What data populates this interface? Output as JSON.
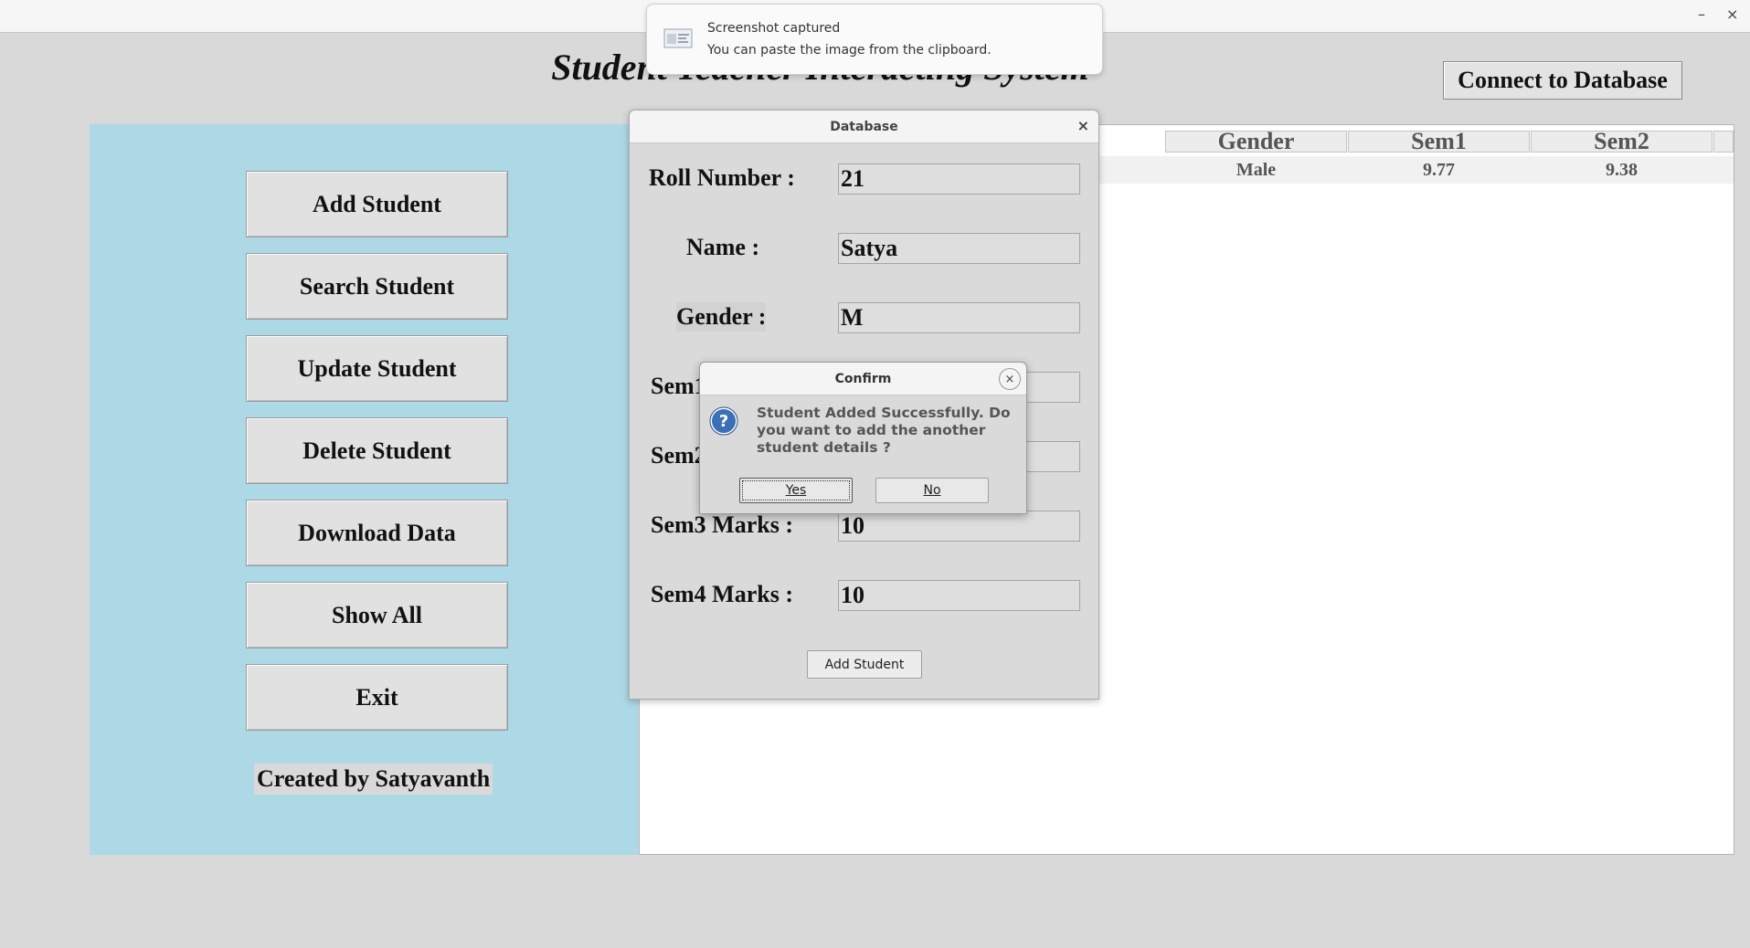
{
  "window": {
    "minimize_glyph": "–",
    "close_glyph": "×"
  },
  "app": {
    "title": "Student Teacher Interacting System",
    "connect_button": "Connect to Database"
  },
  "sidebar": {
    "buttons": [
      "Add Student",
      "Search Student",
      "Update Student",
      "Delete Student",
      "Download Data",
      "Show All",
      "Exit"
    ],
    "credit": "Created by Satyavanth"
  },
  "table": {
    "columns": [
      "Gender",
      "Sem1",
      "Sem2"
    ],
    "rows": [
      [
        "Male",
        "9.77",
        "9.38"
      ]
    ]
  },
  "database_dialog": {
    "title": "Database",
    "close_glyph": "×",
    "fields": [
      {
        "label": "Roll Number :",
        "value": "21"
      },
      {
        "label": "Name :",
        "value": "Satya"
      },
      {
        "label": "Gender :",
        "value": "M"
      },
      {
        "label": "Sem1",
        "value": ""
      },
      {
        "label": "Sem2",
        "value": ""
      },
      {
        "label": "Sem3 Marks :",
        "value": "10"
      },
      {
        "label": "Sem4 Marks :",
        "value": "10"
      }
    ],
    "submit_button": "Add Student"
  },
  "confirm_dialog": {
    "title": "Confirm",
    "close_glyph": "×",
    "icon": "question-icon",
    "message": "Student Added Successfully. Do you want to add the another student details ?",
    "yes_button": "Yes",
    "no_button": "No"
  },
  "notification": {
    "icon": "screenshot-icon",
    "title": "Screenshot captured",
    "body": "You can paste the image from the clipboard."
  }
}
